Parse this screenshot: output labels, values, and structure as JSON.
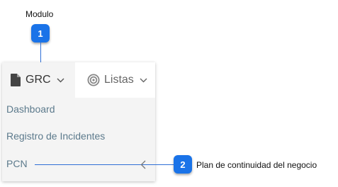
{
  "callouts": [
    {
      "number": "1",
      "text": "Modulo"
    },
    {
      "number": "2",
      "text": "Plan de continuidad del negocio"
    }
  ],
  "tabs": [
    {
      "label": "GRC",
      "icon": "document-icon"
    },
    {
      "label": "Listas",
      "icon": "target-icon"
    }
  ],
  "menu": {
    "items": [
      "Dashboard",
      "Registro de Incidentes",
      "PCN"
    ]
  },
  "colors": {
    "accent": "#1a73e8",
    "link": "#5c7a8c",
    "panel": "#f4f4f4"
  }
}
